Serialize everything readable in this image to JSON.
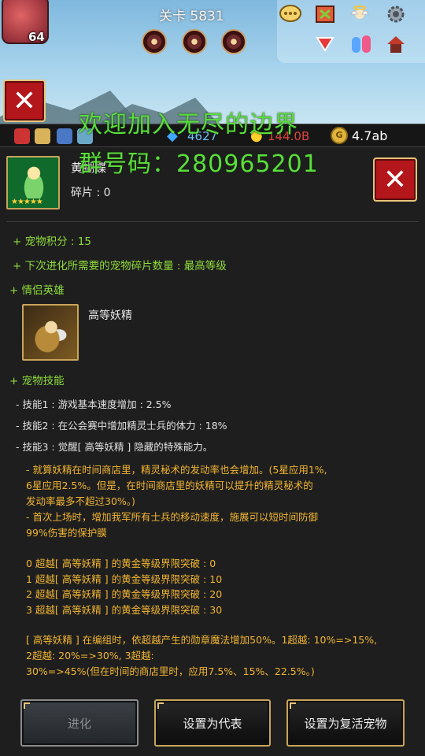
{
  "header": {
    "level": "64",
    "stage_label": "关卡 5831"
  },
  "top_icons": [
    "chat-icon",
    "quest-icon",
    "angel-icon",
    "gear-icon",
    "triangle-down-icon",
    "pets-icon",
    "house-icon"
  ],
  "resources": {
    "gems": "4627",
    "gold": "144.0B",
    "coins": "4.7ab",
    "coin_symbol": "G"
  },
  "watermark": {
    "line1": "欢迎加入无尽的边界",
    "line2": "群号码：280965201"
  },
  "pet": {
    "name": "黄蝴蝶",
    "shards": "碎片 : 0",
    "stars": "★★★★★"
  },
  "info": {
    "score": "+ 宠物积分 : 15",
    "next_evolution": "+ 下次进化所需要的宠物碎片数量 : 最高等级",
    "partner_heading": "+ 情侣英雄",
    "partner_name": "高等妖精",
    "skills_heading": "+ 宠物技能"
  },
  "skills": [
    "- 技能1 : 游戏基本速度增加 : 2.5%",
    "- 技能2 : 在公会赛中增加精灵士兵的体力 : 18%",
    "- 技能3 : 觉醒[ 高等妖精 ] 隐藏的特殊能力。"
  ],
  "description": [
    "- 就算妖精在时间商店里，精灵秘术的发动率也会增加。(5星应用1%,",
    "6星应用2.5%。但是，在时间商店里的妖精可以提升的精灵秘术的",
    "发动率最多不超过30%。)",
    "- 首次上场时，增加我军所有士兵的移动速度，施展可以短时间防御",
    "99%伤害的保护膜"
  ],
  "limit_breaks": [
    "0 超越[ 高等妖精 ] 的黄金等级界限突破 : 0",
    "1 超越[ 高等妖精 ] 的黄金等级界限突破 : 10",
    "2 超越[ 高等妖精 ] 的黄金等级界限突破 : 20",
    "3 超越[ 高等妖精 ] 的黄金等级界限突破 : 30"
  ],
  "medal_text": [
    "[ 高等妖精 ] 在编组时，依超越产生的勋章魔法增加50%。1超越: 10%=>15%,",
    "2超越: 20%=>30%, 3超越:",
    "30%=>45%(但在时间的商店里时，应用7.5%、15%、22.5%。)"
  ],
  "buttons": {
    "evolve": "进化",
    "set_representative": "设置为代表",
    "set_revive_pet": "设置为复活宠物"
  },
  "colors": {
    "accent_green": "#8fdc3a",
    "accent_orange": "#f2b632",
    "close_red": "#b3161b",
    "gold_border": "#c8a45a"
  }
}
